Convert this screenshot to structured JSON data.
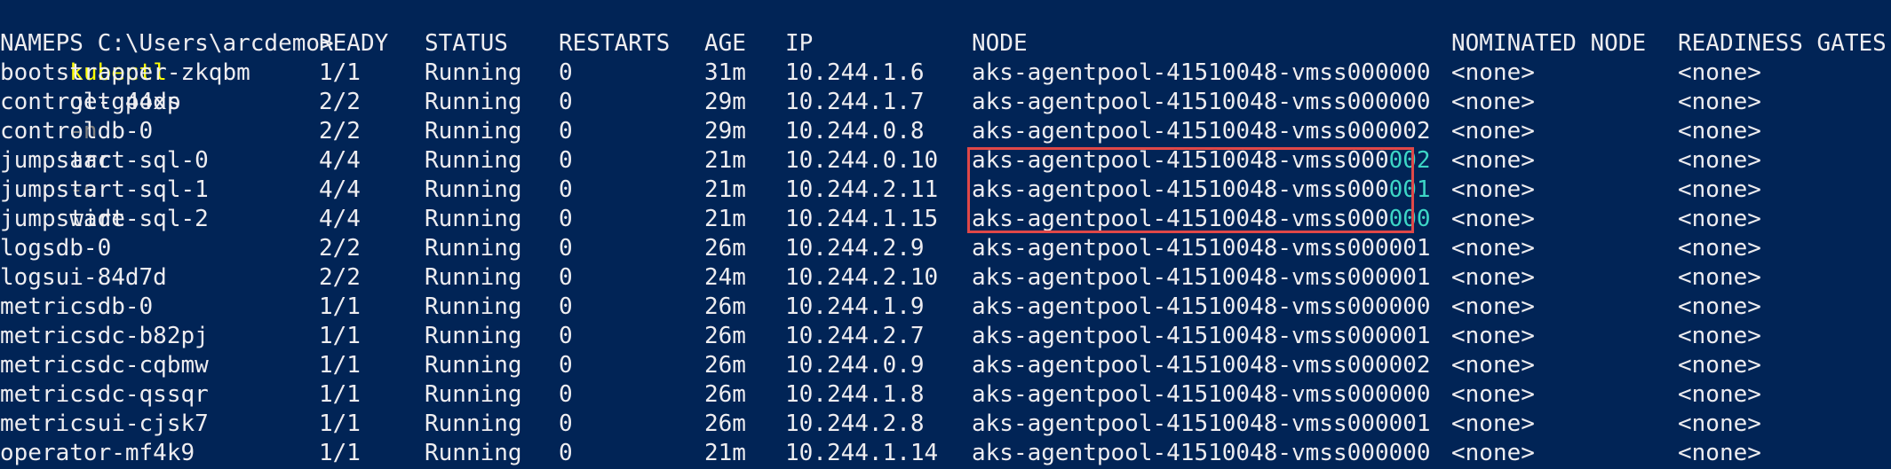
{
  "prompt": {
    "ps": "PS C:\\Users\\arcdemo>",
    "kubectl": "kubectl",
    "get_pods": "get pods",
    "n_flag": "-n",
    "arc": "arc",
    "o_flag": "-o",
    "wide": "wide"
  },
  "headers": {
    "name": "NAME",
    "ready": "READY",
    "status": "STATUS",
    "restarts": "RESTARTS",
    "age": "AGE",
    "ip": "IP",
    "node": "NODE",
    "nominated_node": "NOMINATED NODE",
    "readiness_gates": "READINESS GATES"
  },
  "rows": [
    {
      "name": "bootstrapper-zkqbm",
      "ready": "1/1",
      "status": "Running",
      "restarts": "0",
      "age": "31m",
      "ip": "10.244.1.6",
      "node_prefix": "aks-agentpool-41510048-vmss000",
      "node_suffix": "000",
      "nominated": "<none>",
      "gates": "<none>"
    },
    {
      "name": "control-g44xp",
      "ready": "2/2",
      "status": "Running",
      "restarts": "0",
      "age": "29m",
      "ip": "10.244.1.7",
      "node_prefix": "aks-agentpool-41510048-vmss000",
      "node_suffix": "000",
      "nominated": "<none>",
      "gates": "<none>"
    },
    {
      "name": "controldb-0",
      "ready": "2/2",
      "status": "Running",
      "restarts": "0",
      "age": "29m",
      "ip": "10.244.0.8",
      "node_prefix": "aks-agentpool-41510048-vmss000",
      "node_suffix": "002",
      "nominated": "<none>",
      "gates": "<none>"
    },
    {
      "name": "jumpstart-sql-0",
      "ready": "4/4",
      "status": "Running",
      "restarts": "0",
      "age": "21m",
      "ip": "10.244.0.10",
      "node_prefix": "aks-agentpool-41510048-vmss000",
      "node_suffix": "002",
      "nominated": "<none>",
      "gates": "<none>",
      "highlight": true
    },
    {
      "name": "jumpstart-sql-1",
      "ready": "4/4",
      "status": "Running",
      "restarts": "0",
      "age": "21m",
      "ip": "10.244.2.11",
      "node_prefix": "aks-agentpool-41510048-vmss000",
      "node_suffix": "001",
      "nominated": "<none>",
      "gates": "<none>",
      "highlight": true
    },
    {
      "name": "jumpstart-sql-2",
      "ready": "4/4",
      "status": "Running",
      "restarts": "0",
      "age": "21m",
      "ip": "10.244.1.15",
      "node_prefix": "aks-agentpool-41510048-vmss000",
      "node_suffix": "000",
      "nominated": "<none>",
      "gates": "<none>",
      "highlight": true
    },
    {
      "name": "logsdb-0",
      "ready": "2/2",
      "status": "Running",
      "restarts": "0",
      "age": "26m",
      "ip": "10.244.2.9",
      "node_prefix": "aks-agentpool-41510048-vmss000",
      "node_suffix": "001",
      "nominated": "<none>",
      "gates": "<none>"
    },
    {
      "name": "logsui-84d7d",
      "ready": "2/2",
      "status": "Running",
      "restarts": "0",
      "age": "24m",
      "ip": "10.244.2.10",
      "node_prefix": "aks-agentpool-41510048-vmss000",
      "node_suffix": "001",
      "nominated": "<none>",
      "gates": "<none>"
    },
    {
      "name": "metricsdb-0",
      "ready": "1/1",
      "status": "Running",
      "restarts": "0",
      "age": "26m",
      "ip": "10.244.1.9",
      "node_prefix": "aks-agentpool-41510048-vmss000",
      "node_suffix": "000",
      "nominated": "<none>",
      "gates": "<none>"
    },
    {
      "name": "metricsdc-b82pj",
      "ready": "1/1",
      "status": "Running",
      "restarts": "0",
      "age": "26m",
      "ip": "10.244.2.7",
      "node_prefix": "aks-agentpool-41510048-vmss000",
      "node_suffix": "001",
      "nominated": "<none>",
      "gates": "<none>"
    },
    {
      "name": "metricsdc-cqbmw",
      "ready": "1/1",
      "status": "Running",
      "restarts": "0",
      "age": "26m",
      "ip": "10.244.0.9",
      "node_prefix": "aks-agentpool-41510048-vmss000",
      "node_suffix": "002",
      "nominated": "<none>",
      "gates": "<none>"
    },
    {
      "name": "metricsdc-qssqr",
      "ready": "1/1",
      "status": "Running",
      "restarts": "0",
      "age": "26m",
      "ip": "10.244.1.8",
      "node_prefix": "aks-agentpool-41510048-vmss000",
      "node_suffix": "000",
      "nominated": "<none>",
      "gates": "<none>"
    },
    {
      "name": "metricsui-cjsk7",
      "ready": "1/1",
      "status": "Running",
      "restarts": "0",
      "age": "26m",
      "ip": "10.244.2.8",
      "node_prefix": "aks-agentpool-41510048-vmss000",
      "node_suffix": "001",
      "nominated": "<none>",
      "gates": "<none>"
    },
    {
      "name": "operator-mf4k9",
      "ready": "1/1",
      "status": "Running",
      "restarts": "0",
      "age": "21m",
      "ip": "10.244.1.14",
      "node_prefix": "aks-agentpool-41510048-vmss000",
      "node_suffix": "000",
      "nominated": "<none>",
      "gates": "<none>"
    }
  ],
  "colors": {
    "background": "#012456",
    "text": "#eeedf0",
    "command": "#ffff00",
    "flag": "#808080",
    "highlight_box": "#e04848",
    "highlight_digits": "#3dd6c6"
  }
}
